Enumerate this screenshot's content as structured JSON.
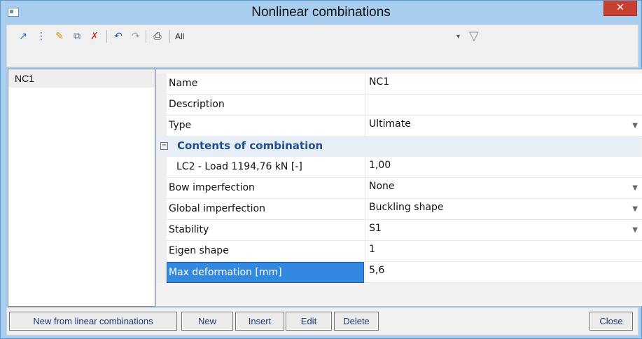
{
  "window": {
    "title": "Nonlinear combinations",
    "close_glyph": "✕"
  },
  "toolbar": {
    "icons": [
      "new-icon",
      "filter-list-icon",
      "edit-icon",
      "copy-icon",
      "delete-icon",
      "undo-icon",
      "redo-icon",
      "print-icon"
    ],
    "filter_value": "All"
  },
  "list": {
    "items": [
      "NC1"
    ]
  },
  "properties": {
    "name_label": "Name",
    "name_value": "NC1",
    "description_label": "Description",
    "description_value": "",
    "type_label": "Type",
    "type_value": "Ultimate",
    "section_title": "Contents of combination",
    "lc2_label": "LC2 - Load 1194,76 kN [-]",
    "lc2_value": "1,00",
    "bow_label": "Bow imperfection",
    "bow_value": "None",
    "global_label": "Global imperfection",
    "global_value": "Buckling shape",
    "stability_label": "Stability",
    "stability_value": "S1",
    "eigen_label": "Eigen shape",
    "eigen_value": "1",
    "maxdef_label": "Max deformation [mm]",
    "maxdef_value": "5,6"
  },
  "footer": {
    "new_from_linear": "New from linear combinations",
    "new": "New",
    "insert": "Insert",
    "edit": "Edit",
    "delete": "Delete",
    "close": "Close"
  },
  "colors": {
    "accent": "#3388e0",
    "titlebar": "#a8cdef",
    "close": "#c84031"
  }
}
